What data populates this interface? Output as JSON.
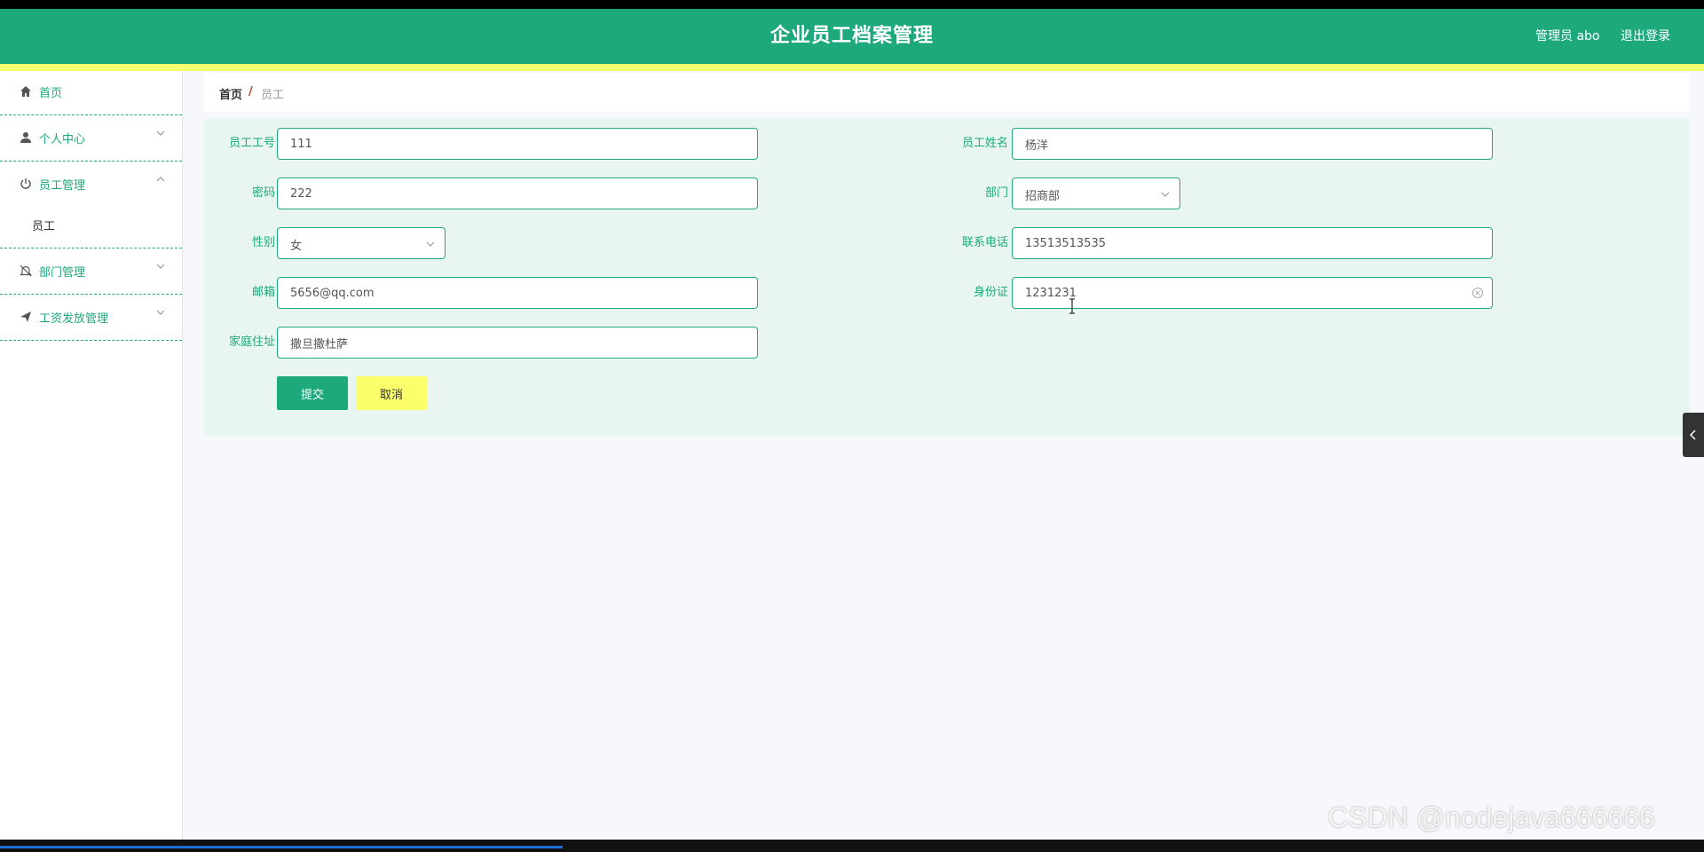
{
  "header": {
    "title": "企业员工档案管理",
    "role_user": "管理员 abo",
    "logout": "退出登录"
  },
  "sidebar": {
    "items": [
      {
        "label": "首页",
        "icon": "home-icon"
      },
      {
        "label": "个人中心",
        "icon": "user-icon"
      },
      {
        "label": "员工管理",
        "icon": "power-icon",
        "expanded": true
      },
      {
        "label": "部门管理",
        "icon": "bell-off-icon"
      },
      {
        "label": "工资发放管理",
        "icon": "send-icon"
      }
    ],
    "subitems": {
      "employee": "员工"
    }
  },
  "breadcrumb": {
    "home": "首页",
    "separator": "/",
    "current": "员工"
  },
  "form": {
    "emp_no": {
      "label": "员工工号",
      "value": "111"
    },
    "emp_name": {
      "label": "员工姓名",
      "value": "杨洋"
    },
    "password": {
      "label": "密码",
      "value": "222"
    },
    "department": {
      "label": "部门",
      "value": "招商部"
    },
    "gender": {
      "label": "性别",
      "value": "女"
    },
    "phone": {
      "label": "联系电话",
      "value": "13513513535"
    },
    "email": {
      "label": "邮箱",
      "value": "5656@qq.com"
    },
    "id_card": {
      "label": "身份证",
      "value": "1231231"
    },
    "address": {
      "label": "家庭住址",
      "value": "撒旦撒杜萨"
    },
    "submit": "提交",
    "cancel": "取消"
  },
  "watermark": "CSDN @nodejava666666",
  "video_progress": 0.33,
  "colors": {
    "primary": "#1ea97c",
    "accent_yellow": "#f4ff6e",
    "panel_bg": "#e8f5f0"
  }
}
